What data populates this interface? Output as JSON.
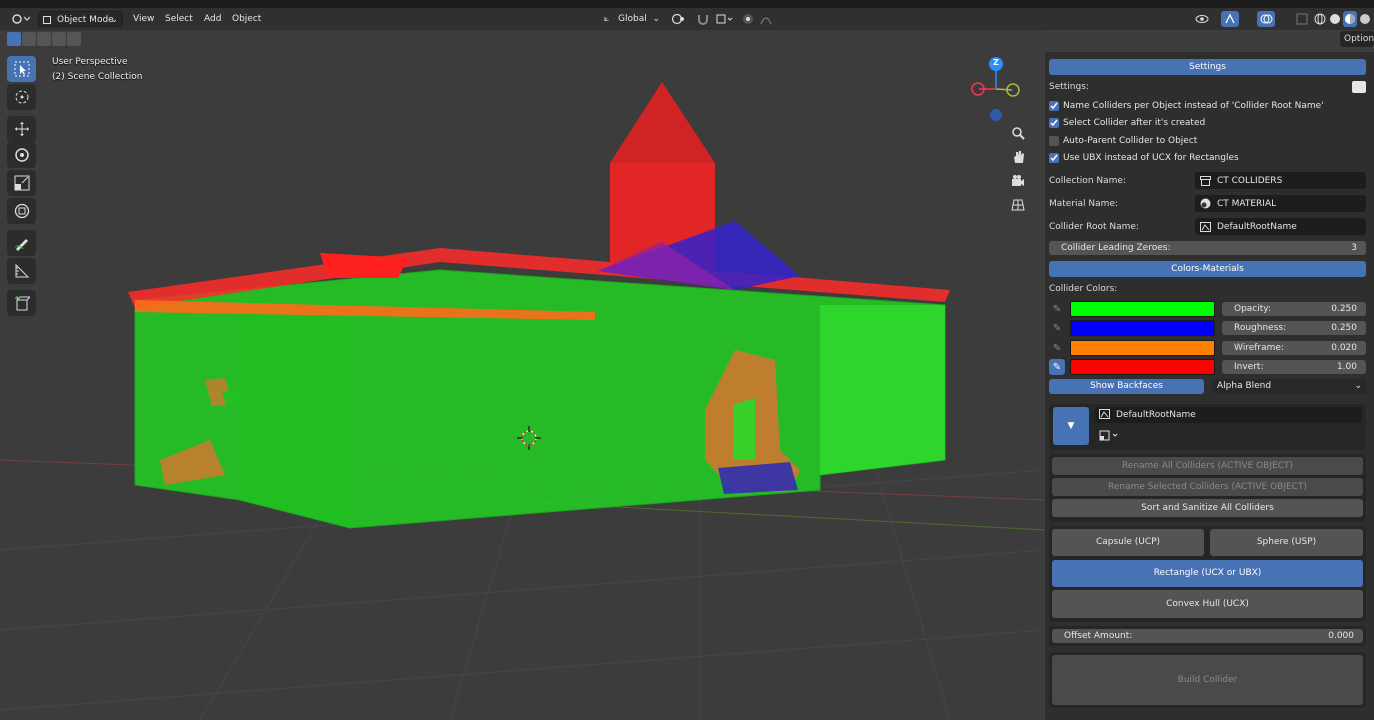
{
  "header": {
    "mode": "Object Mode",
    "menus": [
      "View",
      "Select",
      "Add",
      "Object"
    ],
    "transform_orientation": "Global",
    "options_label": "Options"
  },
  "viewport": {
    "perspective": "User Perspective",
    "collection": "(2) Scene Collection",
    "gizmo": {
      "z": "Z"
    }
  },
  "panel": {
    "settings_tab": "Settings",
    "settings_label": "Settings:",
    "checks": [
      {
        "label": "Name Colliders per Object instead of 'Collider Root Name'",
        "checked": true
      },
      {
        "label": "Select Collider after it's created",
        "checked": true
      },
      {
        "label": "Auto-Parent Collider to Object",
        "checked": false
      },
      {
        "label": "Use UBX instead of UCX for Rectangles",
        "checked": true
      }
    ],
    "fields": [
      {
        "label": "Collection Name:",
        "value": "CT COLLIDERS",
        "icon": "collection-icon"
      },
      {
        "label": "Material Name:",
        "value": "CT MATERIAL",
        "icon": "material-icon"
      },
      {
        "label": "Collider Root Name:",
        "value": "DefaultRootName",
        "icon": "object-data-icon"
      }
    ],
    "leading_zeroes": {
      "label": "Collider Leading Zeroes:",
      "value": "3"
    },
    "colors_tab": "Colors-Materials",
    "collider_colors_label": "Collider Colors:",
    "colors": [
      {
        "color": "#00ff00",
        "prop_label": "Opacity:",
        "prop_value": "0.250",
        "pinned": false
      },
      {
        "color": "#0000ff",
        "prop_label": "Roughness:",
        "prop_value": "0.250",
        "pinned": false
      },
      {
        "color": "#ff8000",
        "prop_label": "Wireframe:",
        "prop_value": "0.020",
        "pinned": false
      },
      {
        "color": "#ff0000",
        "prop_label": "Invert:",
        "prop_value": "1.00",
        "pinned": true
      }
    ],
    "show_backfaces": "Show Backfaces",
    "blend_mode": "Alpha Blend",
    "preset_name": "DefaultRootName",
    "rename_all": "Rename All Colliders (ACTIVE OBJECT)",
    "rename_selected": "Rename Selected Colliders (ACTIVE OBJECT)",
    "sort_sanitize": "Sort and Sanitize All Colliders",
    "capsule": "Capsule (UCP)",
    "sphere": "Sphere (USP)",
    "rectangle": "Rectangle (UCX or UBX)",
    "convex": "Convex Hull (UCX)",
    "offset": {
      "label": "Offset Amount:",
      "value": "0.000"
    },
    "build": "Build Collider"
  }
}
